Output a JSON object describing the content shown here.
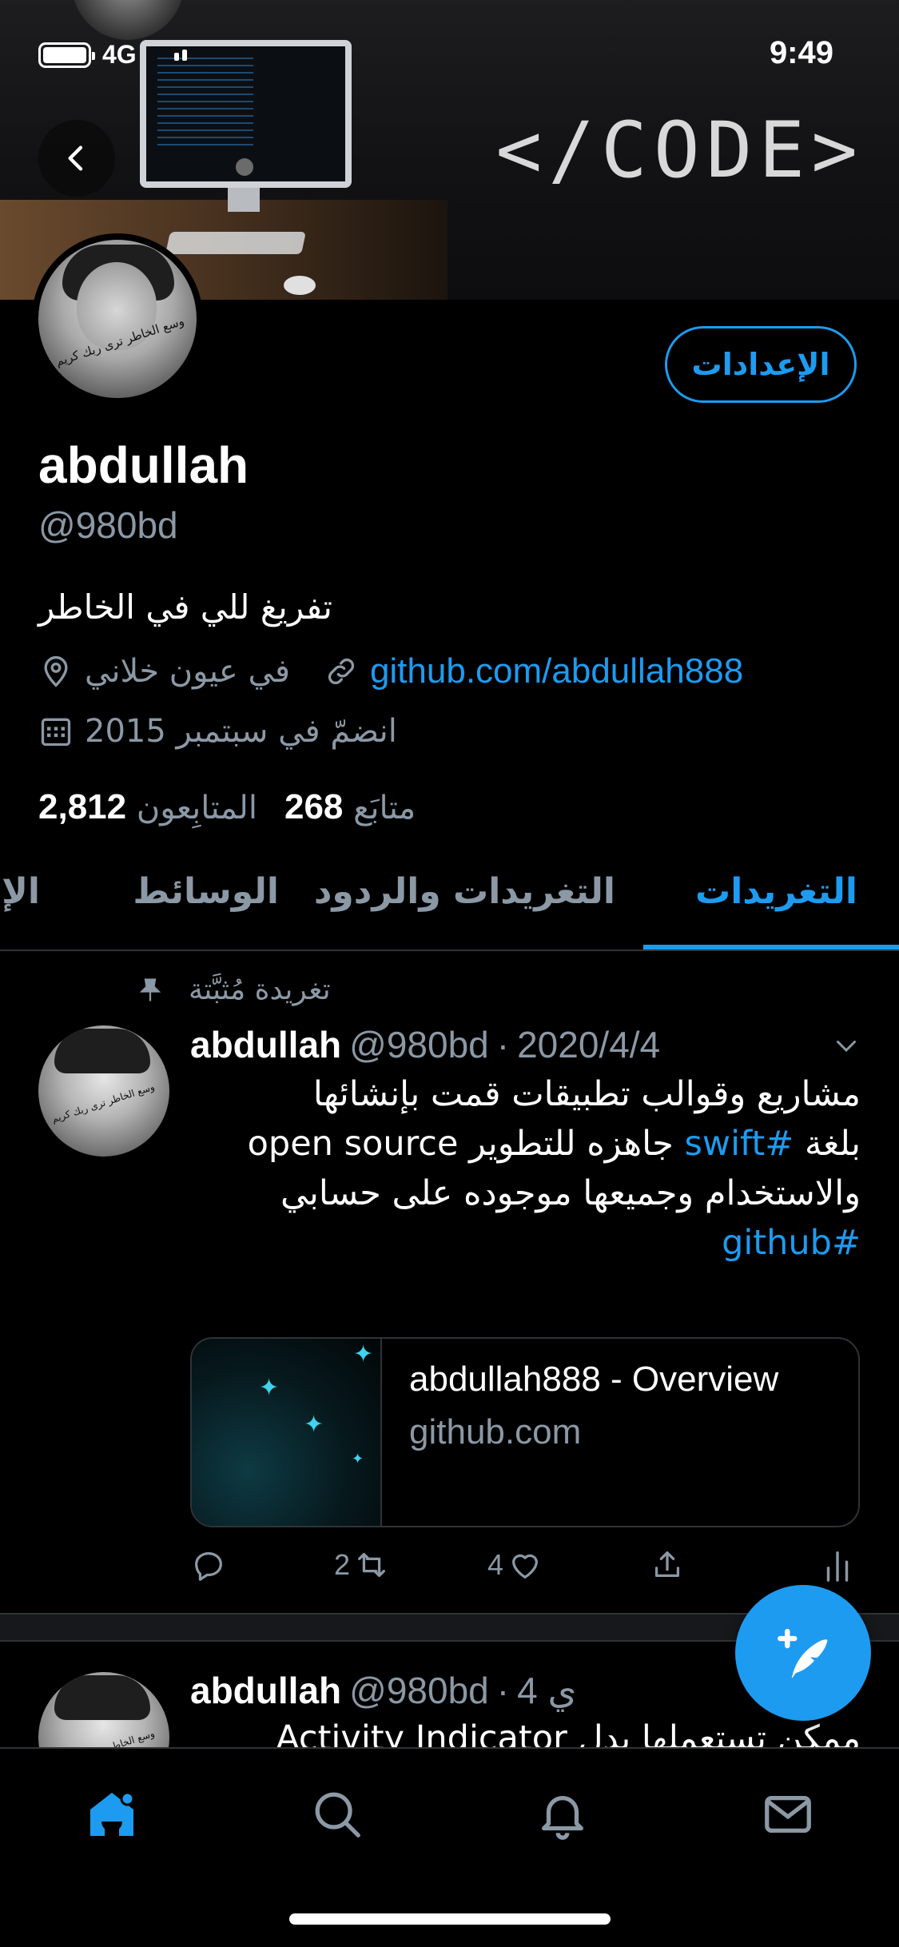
{
  "status_bar": {
    "time": "9:49",
    "network": "4G"
  },
  "banner": {
    "text": "</CODE>"
  },
  "profile": {
    "settings_label": "الإعدادات",
    "name": "abdullah",
    "handle": "@980bd",
    "bio": "تفريغ للي في الخاطر",
    "location": "في عيون خلاني",
    "link": "github.com/abdullah888",
    "joined": "انضمّ في سبتمبر 2015",
    "following_count": "268",
    "following_label": "متابَع",
    "followers_count": "2,812",
    "followers_label": "المتابِعون",
    "avatar_script": "وسع الخاطر ترى ربك كريم"
  },
  "tabs": [
    {
      "label": "التغريدات"
    },
    {
      "label": "التغريدات والردود"
    },
    {
      "label": "الوسائط"
    },
    {
      "label": "الإ"
    }
  ],
  "tweets": [
    {
      "pinned_label": "تغريدة مُثبَّتة",
      "name": "abdullah",
      "handle": "@980bd",
      "dot": "·",
      "date": "2020/4/4",
      "body_line1": "مشاريع وقوالب تطبيقات قمت بإنشائها",
      "body_line2_pre": "بلغة ",
      "body_line2_hash": "#swift",
      "body_line2_post": " جاهزه للتطوير open source",
      "body_line3": "والاستخدام وجميعها موجوده على حسابي",
      "body_hash2": "#github",
      "card_title": "abdullah888 - Overview",
      "card_domain": "github.com",
      "retweets": "2",
      "likes": "4"
    },
    {
      "name": "abdullah",
      "handle": "@980bd",
      "dot": "·",
      "date": "4 ي",
      "body": "ممكن تستعملها بدل Activity Indicator"
    }
  ],
  "colors": {
    "accent": "#1d9bf0",
    "muted": "#8b98a5",
    "background": "#000000",
    "divider": "#2f3336"
  },
  "icons": {
    "nav": [
      "home-icon",
      "search-icon",
      "bell-icon",
      "mail-icon"
    ],
    "fab": "compose-feather-icon"
  }
}
